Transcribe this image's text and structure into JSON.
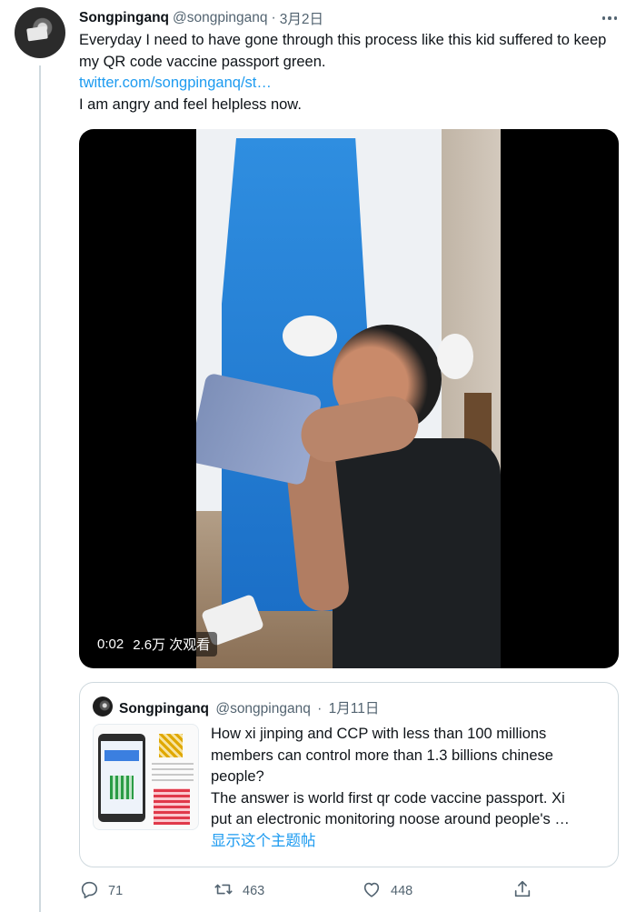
{
  "tweet": {
    "author_name": "Songpinganq",
    "author_handle": "@songpinganq",
    "separator": "·",
    "date": "3月2日",
    "text_line1": "Everyday I need to have gone through this process like this kid suffered to keep my QR code vaccine passport green.",
    "link": "twitter.com/songpinganq/st…",
    "text_line2": "I am angry and feel helpless now."
  },
  "video": {
    "duration": "0:02",
    "views": "2.6万 次观看"
  },
  "quote": {
    "author_name": "Songpinganq",
    "author_handle": "@songpinganq",
    "separator": "·",
    "date": "1月11日",
    "lines": [
      "How xi jinping and CCP with less than 100 millions",
      "members can control more than 1.3 billions chinese",
      "people?",
      "The answer is world first qr code vaccine passport. Xi",
      "put an electronic monitoring noose around people's …"
    ],
    "show_thread": "显示这个主题帖"
  },
  "actions": {
    "reply_count": "71",
    "retweet_count": "463",
    "like_count": "448"
  },
  "icons": {
    "more": "more-icon",
    "reply": "reply-icon",
    "retweet": "retweet-icon",
    "like": "heart-icon",
    "share": "share-icon"
  },
  "colors": {
    "link": "#1d9bf0",
    "secondary_text": "#536471",
    "border": "#cfd9de"
  }
}
